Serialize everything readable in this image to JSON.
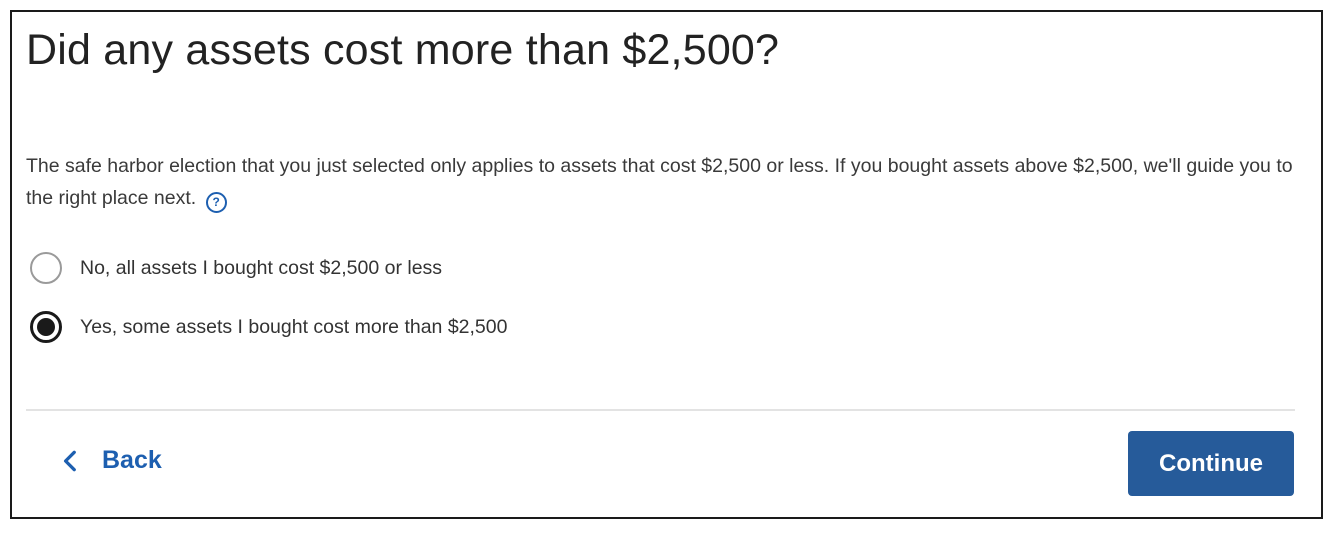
{
  "page": {
    "title": "Did any assets cost more than $2,500?",
    "description": "The safe harbor election that you just selected only applies to assets that cost $2,500 or less. If you bought assets above $2,500, we'll guide you to the right place next.",
    "help_icon": "question-circle-icon",
    "help_glyph": "?"
  },
  "options": [
    {
      "label": "No, all assets I bought cost $2,500 or less",
      "selected": false
    },
    {
      "label": "Yes, some assets I bought cost more than $2,500",
      "selected": true
    }
  ],
  "footer": {
    "back_label": "Back",
    "back_icon": "chevron-left-icon",
    "continue_label": "Continue"
  },
  "colors": {
    "accent": "#1d5fb0",
    "primary_button": "#265b9a",
    "divider": "#e3e3e3"
  }
}
